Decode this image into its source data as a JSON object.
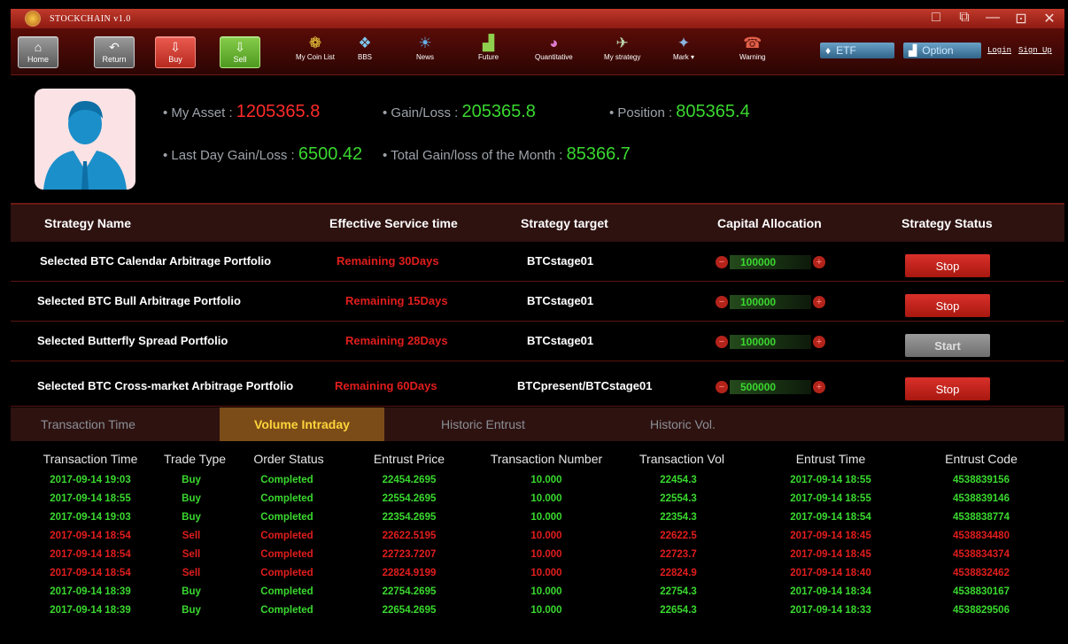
{
  "app": {
    "title": "STOCKCHAIN v1.0"
  },
  "window_controls": [
    "□",
    "⧉",
    "—",
    "⊡",
    "✕"
  ],
  "toolbar": {
    "buttons": [
      {
        "label": "Home",
        "icon": "⌂",
        "color": "gray"
      },
      {
        "label": "Return",
        "icon": "↶",
        "color": "gray"
      },
      {
        "label": "Buy",
        "icon": "⇩",
        "color": "red"
      },
      {
        "label": "Sell",
        "icon": "⇩",
        "color": "green"
      }
    ],
    "icons": [
      {
        "label": "My Coin List",
        "icon": "❁"
      },
      {
        "label": "BBS",
        "icon": "❖"
      },
      {
        "label": "News",
        "icon": "☀"
      },
      {
        "label": "Future",
        "icon": "▟"
      },
      {
        "label": "Quantitative",
        "icon": "◕"
      },
      {
        "label": "My strategy",
        "icon": "✈"
      },
      {
        "label": "Mark ▾",
        "icon": "✦"
      },
      {
        "label": "Warning",
        "icon": "☎"
      }
    ],
    "etf_label": "ETF",
    "option_label": "Option",
    "login_label": "Login",
    "signup_label": "Sign Up"
  },
  "profile": {
    "my_asset_label": "My Asset : ",
    "my_asset": "1205365.8",
    "gain_loss_label": "Gain/Loss : ",
    "gain_loss": "205365.8",
    "position_label": "Position : ",
    "position": "805365.4",
    "last_day_label": "Last Day Gain/Loss : ",
    "last_day": "6500.42",
    "month_label": "Total Gain/loss of the Month : ",
    "month": "85366.7"
  },
  "strategy_table": {
    "headers": [
      "Strategy Name",
      "Effective Service time",
      "Strategy target",
      "Capital Allocation",
      "Strategy Status"
    ],
    "rows": [
      {
        "name": "Selected BTC Calendar Arbitrage Portfolio",
        "remaining": "Remaining 30Days",
        "target": "BTCstage01",
        "capital": "100000",
        "status": "Stop"
      },
      {
        "name": "Selected BTC Bull Arbitrage Portfolio",
        "remaining": "Remaining 15Days",
        "target": "BTCstage01",
        "capital": "100000",
        "status": "Stop"
      },
      {
        "name": "Selected Butterfly Spread Portfolio",
        "remaining": "Remaining 28Days",
        "target": "BTCstage01",
        "capital": "100000",
        "status": "Start"
      },
      {
        "name": "Selected BTC Cross-market Arbitrage Portfolio",
        "remaining": "Remaining 60Days",
        "target": "BTCpresent/BTCstage01",
        "capital": "500000",
        "status": "Stop"
      }
    ]
  },
  "tabs": [
    "Transaction Time",
    "Volume Intraday",
    "Historic Entrust",
    "Historic Vol."
  ],
  "active_tab": "Volume Intraday",
  "transactions": {
    "headers": [
      "Transaction Time",
      "Trade Type",
      "Order Status",
      "Entrust Price",
      "Transaction Number",
      "Transaction Vol",
      "Entrust Time",
      "Entrust Code"
    ],
    "rows": [
      [
        "2017-09-14 19:03",
        "Buy",
        "Completed",
        "22454.2695",
        "10.000",
        "22454.3",
        "2017-09-14 18:55",
        "4538839156"
      ],
      [
        "2017-09-14 18:55",
        "Buy",
        "Completed",
        "22554.2695",
        "10.000",
        "22554.3",
        "2017-09-14 18:55",
        "4538839146"
      ],
      [
        "2017-09-14 19:03",
        "Buy",
        "Completed",
        "22354.2695",
        "10.000",
        "22354.3",
        "2017-09-14 18:54",
        "4538838774"
      ],
      [
        "2017-09-14 18:54",
        "Sell",
        "Completed",
        "22622.5195",
        "10.000",
        "22622.5",
        "2017-09-14 18:45",
        "4538834480"
      ],
      [
        "2017-09-14 18:54",
        "Sell",
        "Completed",
        "22723.7207",
        "10.000",
        "22723.7",
        "2017-09-14 18:45",
        "4538834374"
      ],
      [
        "2017-09-14 18:54",
        "Sell",
        "Completed",
        "22824.9199",
        "10.000",
        "22824.9",
        "2017-09-14 18:40",
        "4538832462"
      ],
      [
        "2017-09-14 18:39",
        "Buy",
        "Completed",
        "22754.2695",
        "10.000",
        "22754.3",
        "2017-09-14 18:34",
        "4538830167"
      ],
      [
        "2017-09-14 18:39",
        "Buy",
        "Completed",
        "22654.2695",
        "10.000",
        "22654.3",
        "2017-09-14 18:33",
        "4538829506"
      ]
    ]
  },
  "colors": {
    "accent": "#c0392b",
    "positive": "#3ad82f",
    "negative": "#e11d1d",
    "tab_active": "#ffd43b"
  }
}
